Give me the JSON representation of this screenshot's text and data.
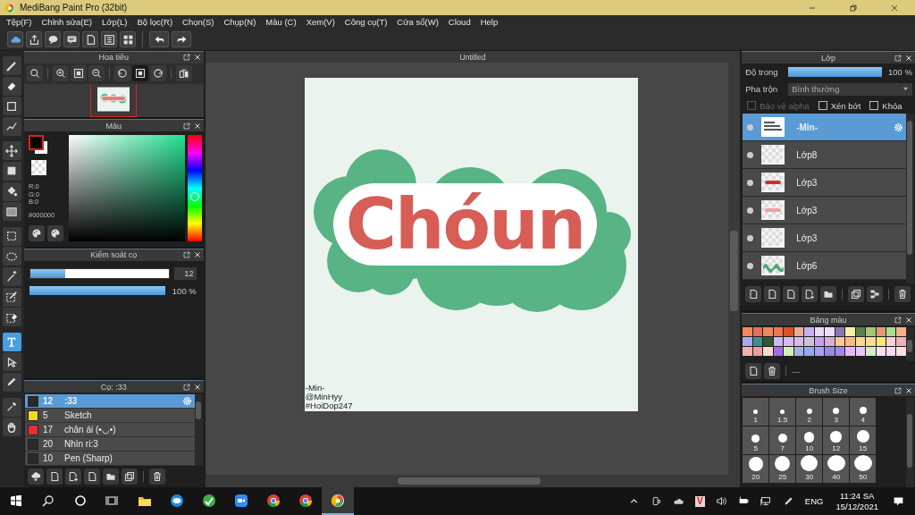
{
  "window": {
    "title": "MediBang Paint Pro (32bit)",
    "controls": [
      {
        "kind": "minimize"
      },
      {
        "kind": "restore"
      },
      {
        "kind": "close"
      }
    ]
  },
  "menu": [
    "Tệp(F)",
    "Chỉnh sửa(E)",
    "Lớp(L)",
    "Bộ lọc(R)",
    "Chọn(S)",
    "Chụp(N)",
    "Màu (C)",
    "Xem(V)",
    "Công cụ(T)",
    "Cửa sổ(W)",
    "Cloud",
    "Help"
  ],
  "toolbar": [
    {
      "kind": "cloud"
    },
    {
      "kind": "share"
    },
    {
      "kind": "comment"
    },
    {
      "kind": "chat"
    },
    {
      "kind": "page"
    },
    {
      "kind": "list"
    },
    {
      "kind": "grid"
    },
    {
      "kind": "undo"
    },
    {
      "kind": "redo"
    }
  ],
  "tools": [
    {
      "kind": "brush",
      "selected": false
    },
    {
      "kind": "eraser",
      "selected": false
    },
    {
      "kind": "square",
      "selected": false
    },
    {
      "kind": "line",
      "selected": false
    },
    {
      "kind": "move",
      "selected": false
    },
    {
      "kind": "fill",
      "selected": false
    },
    {
      "kind": "bucket",
      "selected": false
    },
    {
      "kind": "gradient",
      "selected": false
    },
    {
      "kind": "select",
      "selected": false
    },
    {
      "kind": "lasso",
      "selected": false
    },
    {
      "kind": "wand",
      "selected": false
    },
    {
      "kind": "selpen",
      "selected": false
    },
    {
      "kind": "selerase",
      "selected": false
    },
    {
      "kind": "text",
      "selected": true
    },
    {
      "kind": "pointer",
      "selected": false
    },
    {
      "kind": "pen",
      "selected": false
    },
    {
      "kind": "dropper",
      "selected": false
    },
    {
      "kind": "hand",
      "selected": false
    }
  ],
  "navigator": {
    "title": "Hoa tiêu",
    "buttons": [
      {
        "kind": "zoom-reset"
      },
      {
        "kind": "zoom-in"
      },
      {
        "kind": "fit"
      },
      {
        "kind": "zoom-out"
      },
      {
        "kind": "rotate-left"
      },
      {
        "kind": "fit"
      },
      {
        "kind": "rotate-right"
      },
      {
        "kind": "flip"
      }
    ]
  },
  "color_panel": {
    "title": "Màu",
    "rgb": [
      "R:0",
      "G:0",
      "B:0"
    ],
    "hex": "#000000"
  },
  "brush_control": {
    "title": "Kiểm soát cọ",
    "size": {
      "level": 0.25,
      "reading": "12"
    },
    "opacity": {
      "level": 1,
      "reading": "100 %"
    }
  },
  "brushes": {
    "title": "Cọ: :33",
    "items": [
      {
        "size": "12",
        "name": ":33",
        "color": "#2a2a2a",
        "selected": true
      },
      {
        "size": "5",
        "name": "Sketch",
        "color": "#f0dc1e",
        "selected": false
      },
      {
        "size": "17",
        "name": "chân ái (•◡•)",
        "color": "#e83030",
        "selected": false
      },
      {
        "size": "20",
        "name": "Nhìn ri:3",
        "color": "#2a2a2a",
        "selected": false
      },
      {
        "size": "10",
        "name": "Pen (Sharp)",
        "color": "#2a2a2a",
        "selected": false
      }
    ],
    "buttons": [
      {
        "kind": "cloud-down"
      },
      {
        "kind": "page"
      },
      {
        "kind": "page-add"
      },
      {
        "kind": "page"
      },
      {
        "kind": "folder"
      },
      {
        "kind": "copy"
      },
      {
        "kind": "trash"
      }
    ]
  },
  "canvas": {
    "tab": "Untitled",
    "lettering": "Chóun",
    "signature": [
      "-Min-",
      "@MinHyy",
      "#HoiDop247"
    ]
  },
  "layers": {
    "title": "Lớp",
    "opacity": {
      "label": "Độ trong",
      "level": 1,
      "reading": "100 %"
    },
    "blend": {
      "label": "Pha trộn",
      "value": "Bình thường"
    },
    "options": [
      {
        "label": "Bảo vệ alpha",
        "checked": false,
        "disabled": true
      },
      {
        "label": "Xén bớt",
        "checked": false,
        "disabled": false
      },
      {
        "label": "Khóa",
        "checked": false,
        "disabled": false
      }
    ],
    "items": [
      {
        "name": "-Min-",
        "kind": "text",
        "selected": true
      },
      {
        "name": "Lớp8",
        "kind": "empty",
        "selected": false
      },
      {
        "name": "Lớp3",
        "kind": "red",
        "selected": false
      },
      {
        "name": "Lớp3",
        "kind": "pink",
        "selected": false
      },
      {
        "name": "Lớp3",
        "kind": "empty",
        "selected": false
      },
      {
        "name": "Lớp6",
        "kind": "green",
        "selected": false
      }
    ],
    "buttons": [
      {
        "kind": "page"
      },
      {
        "kind": "page"
      },
      {
        "kind": "page"
      },
      {
        "kind": "page-add"
      },
      {
        "kind": "folder"
      },
      {
        "kind": "copy"
      },
      {
        "kind": "merge"
      },
      {
        "kind": "trash"
      }
    ]
  },
  "palette": {
    "title": "Bảng màu",
    "swatches": [
      {
        "color": "#f08a5d"
      },
      {
        "color": "#e07060"
      },
      {
        "color": "#f0885a"
      },
      {
        "color": "#f07848"
      },
      {
        "color": "#e05020"
      },
      {
        "color": "#e8b090"
      },
      {
        "color": "#c8b0f0"
      },
      {
        "color": "#e8d8f8"
      },
      {
        "color": "#e8e0f8"
      },
      {
        "color": "#8878b8"
      },
      {
        "color": "#f8f0a0"
      },
      {
        "color": "#5a8050"
      },
      {
        "color": "#a0c878"
      },
      {
        "color": "#e89878"
      },
      {
        "color": "#a0e090"
      },
      {
        "color": "#f8b088"
      },
      {
        "color": "#a8a8e8"
      },
      {
        "color": "#409090"
      },
      {
        "color": "#305838"
      },
      {
        "color": "#d0b8f8"
      },
      {
        "color": "#d8b8f0"
      },
      {
        "color": "#d8b8e8"
      },
      {
        "color": "#d0c0d8"
      },
      {
        "color": "#c8a0f0"
      },
      {
        "color": "#d8b0d8"
      },
      {
        "color": "#f8c898"
      },
      {
        "color": "#f8b888"
      },
      {
        "color": "#f8d890"
      },
      {
        "color": "#f8e090"
      },
      {
        "color": "#f8e878"
      },
      {
        "color": "#f8d0d8"
      },
      {
        "color": "#f0b0b8"
      },
      {
        "color": "#f0b0b0"
      },
      {
        "color": "#e8a0a0"
      },
      {
        "color": "#f8d8d0"
      },
      {
        "color": "#a868f0"
      },
      {
        "color": "#d0f0b0"
      },
      {
        "color": "#a8b0e8"
      },
      {
        "color": "#98a8f0"
      },
      {
        "color": "#a8a0f0"
      },
      {
        "color": "#9888e8"
      },
      {
        "color": "#a088e8"
      },
      {
        "color": "#e8b8f8"
      },
      {
        "color": "#e8c8f8"
      },
      {
        "color": "#d0f0c0"
      },
      {
        "color": "#f8e0f0"
      },
      {
        "color": "#f8d8f0"
      },
      {
        "color": "#f8e0e0"
      }
    ],
    "name": "---"
  },
  "brush_size": {
    "title": "Brush Size",
    "sizes": [
      "1",
      "1.5",
      "2",
      "3",
      "4",
      "5",
      "7",
      "10",
      "12",
      "15",
      "20",
      "25",
      "30",
      "40",
      "50"
    ]
  },
  "taskbar": {
    "apps": [
      {
        "kind": "windows",
        "selected": false
      },
      {
        "kind": "search",
        "selected": false
      },
      {
        "kind": "cortana",
        "selected": false
      },
      {
        "kind": "taskview",
        "selected": false
      },
      {
        "kind": "explorer",
        "selected": false
      },
      {
        "kind": "zalo",
        "selected": false
      },
      {
        "kind": "greenapp",
        "selected": false
      },
      {
        "kind": "zoom",
        "selected": false
      },
      {
        "kind": "chrome",
        "selected": false
      },
      {
        "kind": "chrome",
        "selected": false
      },
      {
        "kind": "medibang",
        "selected": true
      }
    ],
    "tray": [
      {
        "kind": "caret"
      },
      {
        "kind": "meet"
      },
      {
        "kind": "onedrive"
      },
      {
        "kind": "badge",
        "text": "V"
      },
      {
        "kind": "volume"
      },
      {
        "kind": "battery"
      },
      {
        "kind": "network"
      },
      {
        "kind": "pen"
      }
    ],
    "language": "ENG",
    "time": "11:24 SA",
    "date": "15/12/2021"
  }
}
